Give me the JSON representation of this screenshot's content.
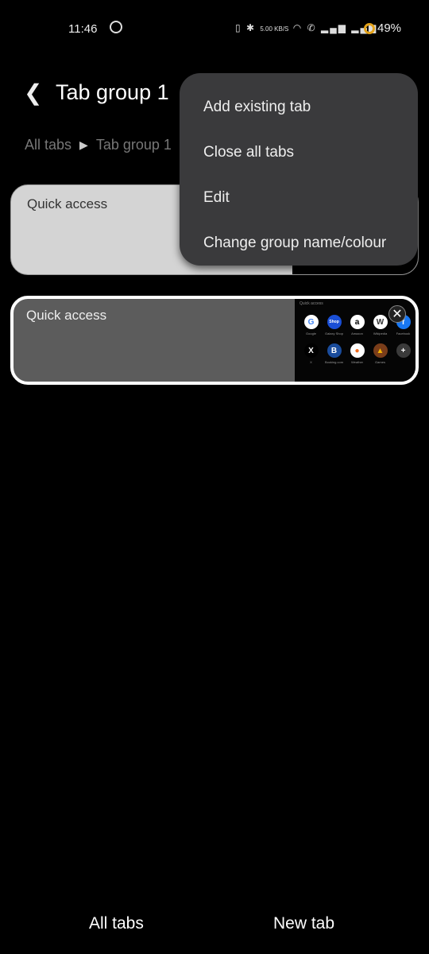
{
  "status": {
    "time": "11:46",
    "net_speed": "5.00 KB/S",
    "battery": "49%"
  },
  "header": {
    "title": "Tab group 1"
  },
  "breadcrumb": {
    "root": "All tabs",
    "current": "Tab group 1"
  },
  "tabs": [
    {
      "label": "Quick access",
      "thumb_title": "Quick access",
      "selected": false
    },
    {
      "label": "Quick access",
      "thumb_title": "Quick access",
      "selected": true
    }
  ],
  "quick_access_apps": [
    {
      "name": "Google",
      "glyph": "G",
      "color": "#ffffff",
      "fg": "#4285f4"
    },
    {
      "name": "Galaxy Shop",
      "glyph": "Shop",
      "color": "#1a4fd6",
      "fg": "#ffffff"
    },
    {
      "name": "Amazon",
      "glyph": "a",
      "color": "#ffffff",
      "fg": "#000000"
    },
    {
      "name": "Wikipedia",
      "glyph": "W",
      "color": "#ffffff",
      "fg": "#333333"
    },
    {
      "name": "Facebook",
      "glyph": "f",
      "color": "#1877f2",
      "fg": "#ffffff"
    },
    {
      "name": "X",
      "glyph": "X",
      "color": "#000000",
      "fg": "#ffffff"
    },
    {
      "name": "Booking.com",
      "glyph": "B",
      "color": "#1a4c9c",
      "fg": "#ffffff"
    },
    {
      "name": "Weather",
      "glyph": "●",
      "color": "#ffffff",
      "fg": "#f26b1d"
    },
    {
      "name": "Games",
      "glyph": "▲",
      "color": "#7a3d1a",
      "fg": "#f5b400"
    },
    {
      "name": "",
      "glyph": "+",
      "color": "#3a3a3a",
      "fg": "#ffffff"
    }
  ],
  "menu": {
    "items": [
      "Add existing tab",
      "Close all tabs",
      "Edit",
      "Change group name/colour"
    ]
  },
  "bottom": {
    "all_tabs": "All tabs",
    "new_tab": "New tab"
  }
}
